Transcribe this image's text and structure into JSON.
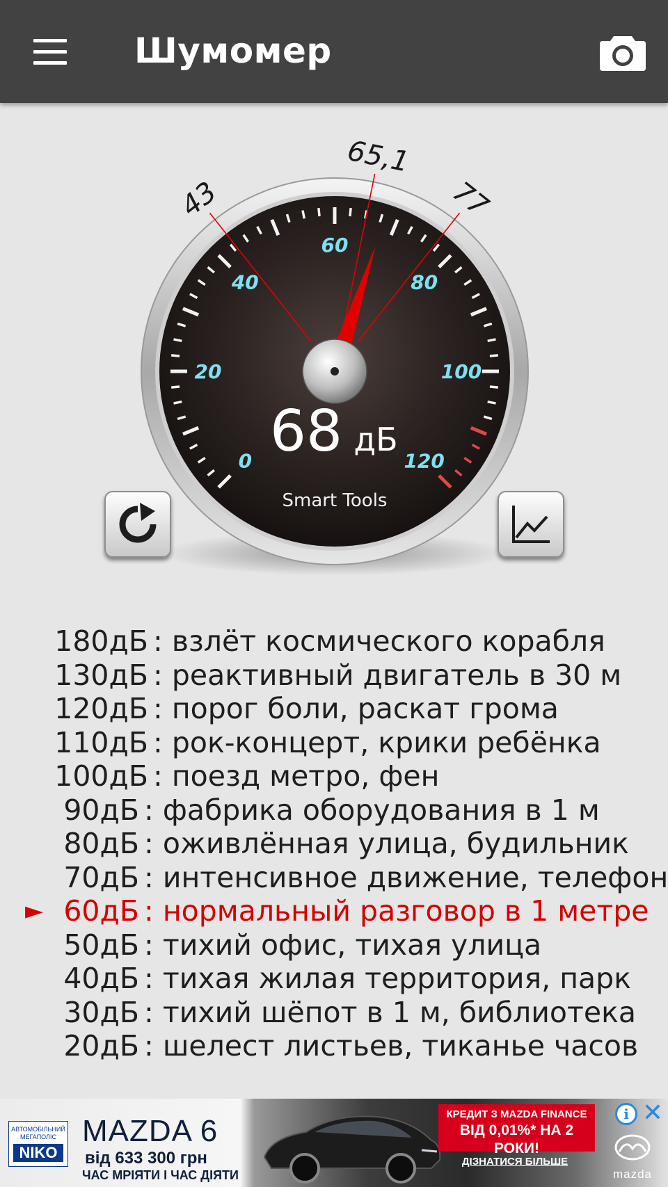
{
  "app": {
    "title": "Шумомер",
    "icons": {
      "menu": "hamburger-menu-icon",
      "camera": "camera-icon"
    }
  },
  "gauge": {
    "current_value": "68",
    "unit": "дБ",
    "brand": "Smart Tools",
    "min_marker": "43",
    "avg_marker": "65,1",
    "max_marker": "77",
    "scale_labels": [
      "0",
      "20",
      "40",
      "60",
      "80",
      "100",
      "120"
    ],
    "scale_min": 0,
    "scale_max": 120,
    "needle_value": 68,
    "min_value": 43,
    "avg_value": 65.1,
    "max_value": 77,
    "red_zone_start": 110,
    "colors": {
      "scale_label": "#7ee0f0",
      "needle": "#e00000",
      "marker_line": "#e00000",
      "red_zone": "#e04848"
    }
  },
  "buttons": {
    "reset_icon": "refresh-icon",
    "graph_icon": "line-chart-icon"
  },
  "reference": {
    "active_index": 8,
    "active_marker": "►",
    "rows": [
      {
        "db": "180дБ",
        "desc": ": взлёт космического корабля"
      },
      {
        "db": "130дБ",
        "desc": ": реактивный двигатель в 30 м"
      },
      {
        "db": "120дБ",
        "desc": ": порог боли, раскат грома"
      },
      {
        "db": "110дБ",
        "desc": ": рок-концерт, крики ребёнка"
      },
      {
        "db": "100дБ",
        "desc": ": поезд метро, фен"
      },
      {
        "db": "90дБ",
        "desc": ": фабрика оборудования в 1 м"
      },
      {
        "db": "80дБ",
        "desc": ": оживлённая улица, будильник"
      },
      {
        "db": "70дБ",
        "desc": ": интенсивное движение, телефон"
      },
      {
        "db": "60дБ",
        "desc": ": нормальный разговор в 1 метре"
      },
      {
        "db": "50дБ",
        "desc": ": тихий офис, тихая улица"
      },
      {
        "db": "40дБ",
        "desc": ": тихая жилая территория, парк"
      },
      {
        "db": "30дБ",
        "desc": ": тихий шёпот в 1 м, библиотека"
      },
      {
        "db": "20дБ",
        "desc": ": шелест листьев, тиканье часов"
      }
    ],
    "colors": {
      "normal": "#1e1e1e",
      "active": "#d50000"
    }
  },
  "ad": {
    "dealer_small": "АВТОМОБІЛЬНИЙ МЕГАПОЛІС",
    "dealer_logo": "NIKO",
    "title": "MAZDA 6",
    "price": "від 633 300 грн",
    "slogan": "ЧАС МРІЯТИ І ЧАС ДІЯТИ",
    "credit_line1": "КРЕДИТ З MAZDA FINANCE",
    "credit_line2": "ВІД 0,01%* НА 2 РОКИ!",
    "more": "ДІЗНАТИСЯ БІЛЬШЕ",
    "brand": "mazda",
    "info_icon_glyph": "i",
    "close_glyph": "✕"
  }
}
